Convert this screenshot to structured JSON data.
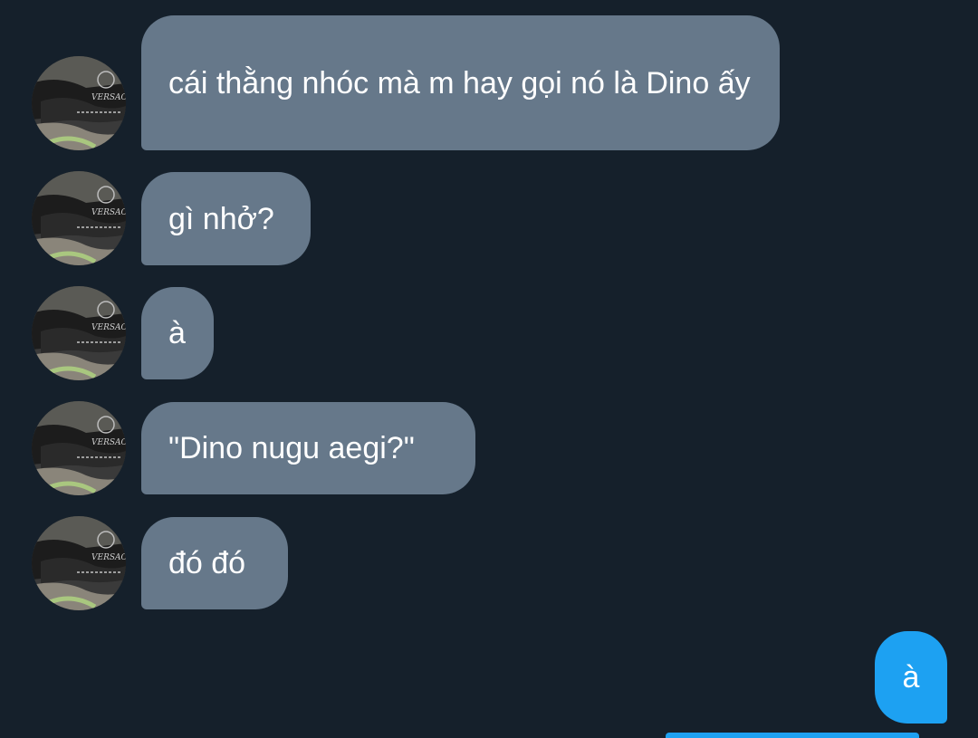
{
  "conversation": {
    "incoming": [
      {
        "text": "cái thằng nhóc mà m hay gọi nó là Dino ấy"
      },
      {
        "text": "gì nhở?"
      },
      {
        "text": "à"
      },
      {
        "text": "\"Dino nugu aegi?\""
      },
      {
        "text": "đó đó"
      }
    ],
    "outgoing": [
      {
        "text": "à"
      }
    ]
  },
  "avatar": {
    "icon": "contact-avatar-photo",
    "photo_text": "VERSACE"
  },
  "colors": {
    "background": "#15202b",
    "incoming_bubble": "#66788a",
    "outgoing_bubble": "#1da1f2",
    "text": "#ffffff"
  }
}
